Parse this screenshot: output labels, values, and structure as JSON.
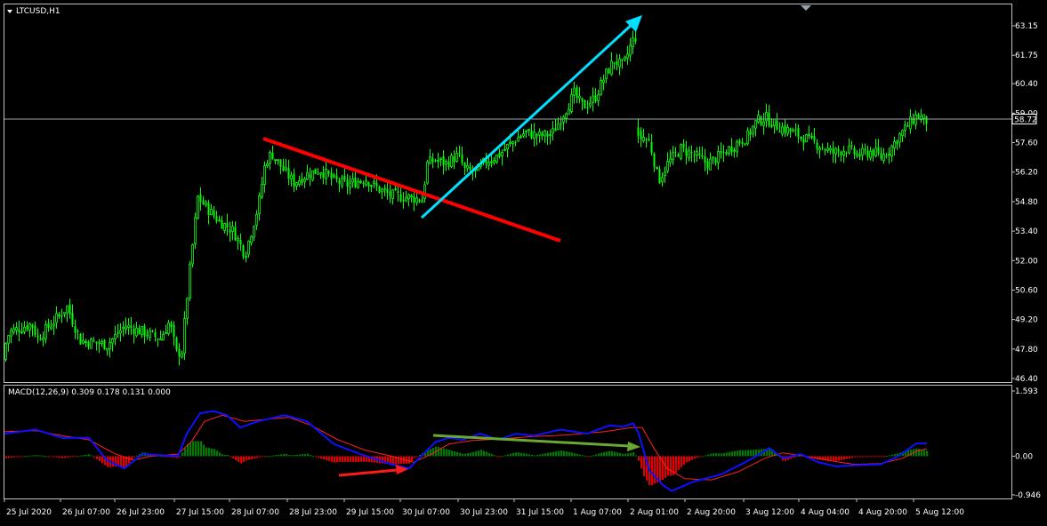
{
  "window": {
    "symbol_label": "LTCUSD,H1"
  },
  "price_scale": {
    "ticks": [
      "63.15",
      "61.75",
      "60.40",
      "59.00",
      "57.60",
      "56.20",
      "54.80",
      "53.40",
      "52.00",
      "50.60",
      "49.20",
      "47.80",
      "46.40"
    ],
    "current_price": "58.72"
  },
  "macd_panel": {
    "label": "MACD(12,26,9) 0.309 0.178 0.131 0.000",
    "ticks": [
      "1.593",
      "0.00",
      "-0.946"
    ]
  },
  "time_axis": {
    "ticks": [
      "25 Jul 2020",
      "26 Jul 07:00",
      "26 Jul 23:00",
      "27 Jul 15:00",
      "28 Jul 07:00",
      "28 Jul 23:00",
      "29 Jul 15:00",
      "30 Jul 07:00",
      "30 Jul 23:00",
      "31 Jul 15:00",
      "1 Aug 07:00",
      "2 Aug 01:00",
      "2 Aug 20:00",
      "3 Aug 12:00",
      "4 Aug 04:00",
      "4 Aug 20:00",
      "5 Aug 12:00"
    ]
  },
  "colors": {
    "background": "#000000",
    "candles": "#00ff00",
    "grid_frame": "#c0c0c0",
    "price_line": "#9aa3ad",
    "macd_line": "#1010ff",
    "signal_line": "#ff2020",
    "hist_positive": "#007a00",
    "hist_negative": "#e00000",
    "downtrend_line": "#ff0000",
    "uptrend_arrow": "#00e0ff",
    "divergence_arrow": "#6aa832",
    "hist_arrow": "#ff1a1a"
  },
  "chart_data": [
    {
      "type": "candlestick",
      "title": "LTCUSD,H1",
      "xlabel": "",
      "ylabel": "",
      "ylim": [
        46.4,
        63.8
      ],
      "grid": false,
      "current_price": 58.72,
      "close_anchors": [
        [
          0,
          47.3
        ],
        [
          10,
          48.6
        ],
        [
          35,
          49.0
        ],
        [
          42,
          48.3
        ],
        [
          75,
          49.8
        ],
        [
          90,
          48.2
        ],
        [
          120,
          48.0
        ],
        [
          140,
          48.9
        ],
        [
          160,
          48.6
        ],
        [
          180,
          48.3
        ],
        [
          190,
          49.1
        ],
        [
          198,
          47.6
        ],
        [
          204,
          47.7
        ],
        [
          212,
          51.2
        ],
        [
          222,
          55.0
        ],
        [
          232,
          54.5
        ],
        [
          245,
          53.9
        ],
        [
          262,
          53.4
        ],
        [
          275,
          52.3
        ],
        [
          290,
          54.6
        ],
        [
          298,
          56.7
        ],
        [
          305,
          57.1
        ],
        [
          318,
          56.3
        ],
        [
          330,
          55.7
        ],
        [
          345,
          56.1
        ],
        [
          360,
          56.3
        ],
        [
          375,
          55.8
        ],
        [
          390,
          55.6
        ],
        [
          410,
          55.9
        ],
        [
          425,
          55.4
        ],
        [
          438,
          55.1
        ],
        [
          460,
          55.0
        ],
        [
          474,
          54.9
        ],
        [
          480,
          56.6
        ],
        [
          490,
          56.8
        ],
        [
          500,
          56.6
        ],
        [
          515,
          57.0
        ],
        [
          522,
          56.3
        ],
        [
          535,
          56.2
        ],
        [
          545,
          56.7
        ],
        [
          560,
          57.0
        ],
        [
          575,
          57.6
        ],
        [
          590,
          58.1
        ],
        [
          605,
          57.9
        ],
        [
          620,
          58.0
        ],
        [
          632,
          58.9
        ],
        [
          645,
          59.9
        ],
        [
          655,
          59.3
        ],
        [
          668,
          59.7
        ],
        [
          680,
          60.8
        ],
        [
          690,
          61.5
        ],
        [
          700,
          61.2
        ],
        [
          710,
          62.4
        ],
        [
          716,
          62.7
        ],
        [
          717,
          57.7
        ],
        [
          722,
          57.9
        ],
        [
          730,
          57.6
        ],
        [
          740,
          55.8
        ],
        [
          750,
          56.6
        ],
        [
          765,
          57.3
        ],
        [
          780,
          57.0
        ],
        [
          795,
          56.6
        ],
        [
          810,
          57.0
        ],
        [
          825,
          57.5
        ],
        [
          840,
          57.9
        ],
        [
          850,
          58.6
        ],
        [
          860,
          58.8
        ],
        [
          872,
          58.4
        ],
        [
          885,
          58.2
        ],
        [
          900,
          57.9
        ],
        [
          920,
          57.5
        ],
        [
          935,
          57.1
        ],
        [
          950,
          57.3
        ],
        [
          965,
          57.0
        ],
        [
          980,
          57.2
        ],
        [
          990,
          56.9
        ],
        [
          1000,
          57.3
        ],
        [
          1010,
          57.9
        ],
        [
          1020,
          58.4
        ],
        [
          1030,
          58.9
        ],
        [
          1042,
          58.6
        ]
      ]
    },
    {
      "type": "macd",
      "title": "MACD(12,26,9) 0.309 0.178 0.131 0.000",
      "params": [
        12,
        26,
        9
      ],
      "values": {
        "macd": 0.309,
        "signal": 0.178,
        "histogram": 0.131,
        "zero": 0.0
      },
      "ylim": [
        -0.946,
        1.593
      ],
      "macd_anchors": [
        [
          5,
          0.55
        ],
        [
          40,
          0.65
        ],
        [
          70,
          0.45
        ],
        [
          100,
          0.45
        ],
        [
          120,
          -0.1
        ],
        [
          140,
          -0.3
        ],
        [
          160,
          0.05
        ],
        [
          200,
          0.0
        ],
        [
          210,
          0.55
        ],
        [
          225,
          1.05
        ],
        [
          240,
          1.1
        ],
        [
          255,
          1.0
        ],
        [
          270,
          0.7
        ],
        [
          290,
          0.85
        ],
        [
          320,
          1.0
        ],
        [
          345,
          0.85
        ],
        [
          375,
          0.3
        ],
        [
          405,
          0.05
        ],
        [
          440,
          -0.2
        ],
        [
          460,
          -0.3
        ],
        [
          478,
          0.1
        ],
        [
          490,
          0.35
        ],
        [
          505,
          0.45
        ],
        [
          520,
          0.4
        ],
        [
          540,
          0.55
        ],
        [
          560,
          0.4
        ],
        [
          580,
          0.55
        ],
        [
          600,
          0.5
        ],
        [
          630,
          0.65
        ],
        [
          660,
          0.55
        ],
        [
          685,
          0.75
        ],
        [
          700,
          0.72
        ],
        [
          712,
          0.8
        ],
        [
          718,
          0.55
        ],
        [
          730,
          -0.35
        ],
        [
          745,
          -0.7
        ],
        [
          755,
          -0.85
        ],
        [
          780,
          -0.62
        ],
        [
          810,
          -0.45
        ],
        [
          835,
          -0.18
        ],
        [
          850,
          0.0
        ],
        [
          865,
          0.2
        ],
        [
          880,
          -0.05
        ],
        [
          900,
          0.05
        ],
        [
          920,
          -0.15
        ],
        [
          940,
          -0.25
        ],
        [
          965,
          -0.22
        ],
        [
          990,
          -0.2
        ],
        [
          1010,
          0.0
        ],
        [
          1030,
          0.31
        ],
        [
          1042,
          0.31
        ]
      ],
      "signal_anchors": [
        [
          5,
          0.6
        ],
        [
          40,
          0.62
        ],
        [
          70,
          0.5
        ],
        [
          100,
          0.4
        ],
        [
          130,
          0.05
        ],
        [
          150,
          -0.1
        ],
        [
          170,
          0.0
        ],
        [
          200,
          0.05
        ],
        [
          215,
          0.35
        ],
        [
          230,
          0.85
        ],
        [
          250,
          1.0
        ],
        [
          275,
          0.85
        ],
        [
          300,
          0.9
        ],
        [
          325,
          0.95
        ],
        [
          350,
          0.75
        ],
        [
          380,
          0.4
        ],
        [
          410,
          0.15
        ],
        [
          440,
          0.0
        ],
        [
          465,
          -0.15
        ],
        [
          485,
          0.05
        ],
        [
          505,
          0.3
        ],
        [
          530,
          0.38
        ],
        [
          560,
          0.42
        ],
        [
          600,
          0.48
        ],
        [
          640,
          0.52
        ],
        [
          680,
          0.6
        ],
        [
          710,
          0.7
        ],
        [
          722,
          0.7
        ],
        [
          735,
          0.2
        ],
        [
          750,
          -0.3
        ],
        [
          770,
          -0.55
        ],
        [
          800,
          -0.58
        ],
        [
          830,
          -0.38
        ],
        [
          860,
          -0.05
        ],
        [
          880,
          0.08
        ],
        [
          905,
          0.0
        ],
        [
          930,
          -0.1
        ],
        [
          960,
          -0.2
        ],
        [
          990,
          -0.18
        ],
        [
          1015,
          -0.05
        ],
        [
          1030,
          0.12
        ],
        [
          1042,
          0.18
        ]
      ]
    }
  ],
  "annotations": [
    "downtrend line",
    "uptrend arrow",
    "MACD divergence arrow",
    "MACD histogram arrow"
  ]
}
